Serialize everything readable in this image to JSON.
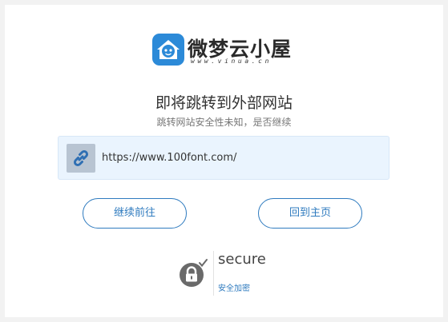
{
  "logo": {
    "name": "微梦云小屋",
    "domain": "www.vinua.cn"
  },
  "title": "即将跳转到外部网站",
  "subtitle": "跳转网站安全性未知，是否继续",
  "target_url": "https://www.100font.com/",
  "buttons": {
    "continue_label": "继续前往",
    "home_label": "回到主页"
  },
  "secure": {
    "title": "secure",
    "subtitle": "安全加密"
  },
  "colors": {
    "accent": "#2f7bbf",
    "url_box_bg": "#eaf4fe",
    "logo_blue": "#2c8ad8"
  },
  "icons": {
    "logo": "house-face-icon",
    "link": "link-chain-icon",
    "secure": "padlock-check-icon"
  }
}
